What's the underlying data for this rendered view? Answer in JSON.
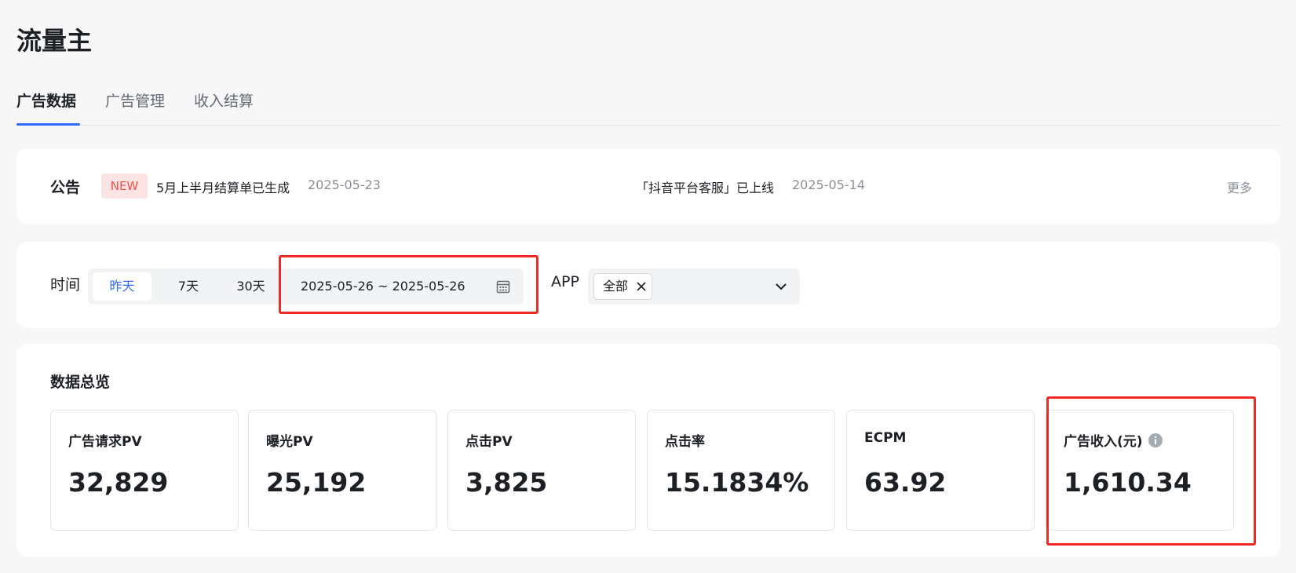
{
  "page": {
    "title": "流量主"
  },
  "tabs": [
    {
      "label": "广告数据",
      "active": true
    },
    {
      "label": "广告管理",
      "active": false
    },
    {
      "label": "收入结算",
      "active": false
    }
  ],
  "notice": {
    "label": "公告",
    "badge": "NEW",
    "items": [
      {
        "text": "5月上半月结算单已生成",
        "date": "2025-05-23"
      },
      {
        "text": "「抖音平台客服」已上线",
        "date": "2025-05-14"
      }
    ],
    "more": "更多"
  },
  "filter": {
    "time_label": "时间",
    "ranges": [
      {
        "label": "昨天",
        "active": true
      },
      {
        "label": "7天",
        "active": false
      },
      {
        "label": "30天",
        "active": false
      }
    ],
    "date_range": "2025-05-26 ~ 2025-05-26",
    "app_label": "APP",
    "app_selected": "全部"
  },
  "overview": {
    "title": "数据总览",
    "metrics": [
      {
        "label": "广告请求PV",
        "value": "32,829"
      },
      {
        "label": "曝光PV",
        "value": "25,192"
      },
      {
        "label": "点击PV",
        "value": "3,825"
      },
      {
        "label": "点击率",
        "value": "15.1834%"
      },
      {
        "label": "ECPM",
        "value": "63.92"
      },
      {
        "label": "广告收入(元)",
        "value": "1,610.34"
      }
    ]
  },
  "colors": {
    "accent": "#2f6bff",
    "highlight": "#ee2a22",
    "badge_bg": "#fde4e4",
    "badge_text": "#f0524b"
  },
  "icons": [
    "calendar-icon",
    "close-icon",
    "chevron-down-icon",
    "info-icon"
  ]
}
